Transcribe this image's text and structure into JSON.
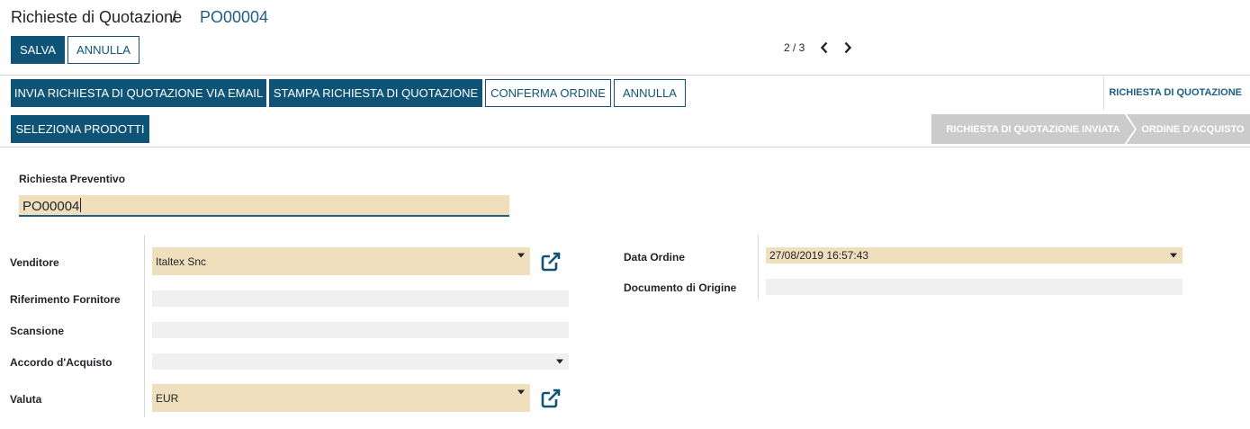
{
  "breadcrumb": {
    "root": "Richieste di Quotazione",
    "separator": "/",
    "current": "PO00004"
  },
  "actions": {
    "save_label": "SALVA",
    "discard_label": "ANNULLA"
  },
  "pager": {
    "value": "2 / 3"
  },
  "header_buttons": {
    "send_email": "INVIA RICHIESTA DI QUOTAZIONE VIA EMAIL",
    "print": "STAMPA RICHIESTA DI QUOTAZIONE",
    "confirm": "CONFERMA ORDINE",
    "cancel": "ANNULLA",
    "select_products": "SELEZIONA PRODOTTI"
  },
  "statusbar": {
    "current": "RICHIESTA DI QUOTAZIONE",
    "stages": [
      "RICHIESTA DI QUOTAZIONE INVIATA",
      "ORDINE D'ACQUISTO"
    ]
  },
  "form": {
    "title_label": "Richiesta Preventivo",
    "title_value": "PO00004",
    "vendor": {
      "label": "Venditore",
      "value": "Italtex Snc"
    },
    "vendor_ref": {
      "label": "Riferimento Fornitore",
      "value": ""
    },
    "scan": {
      "label": "Scansione",
      "value": ""
    },
    "agreement": {
      "label": "Accordo d'Acquisto",
      "value": ""
    },
    "currency": {
      "label": "Valuta",
      "value": "EUR"
    },
    "order_date": {
      "label": "Data Ordine",
      "value": "27/08/2019 16:57:43"
    },
    "origin": {
      "label": "Documento di Origine",
      "value": ""
    }
  },
  "colors": {
    "primary": "#0f5476",
    "link": "#1d5f85",
    "required_bg": "#efdfbd",
    "field_bg": "#f0f0f0",
    "stage_bg": "#cbcbcb"
  },
  "icons": {
    "prev": "chevron-left-icon",
    "next": "chevron-right-icon",
    "external": "external-link-icon",
    "dropdown": "caret-down-icon"
  }
}
